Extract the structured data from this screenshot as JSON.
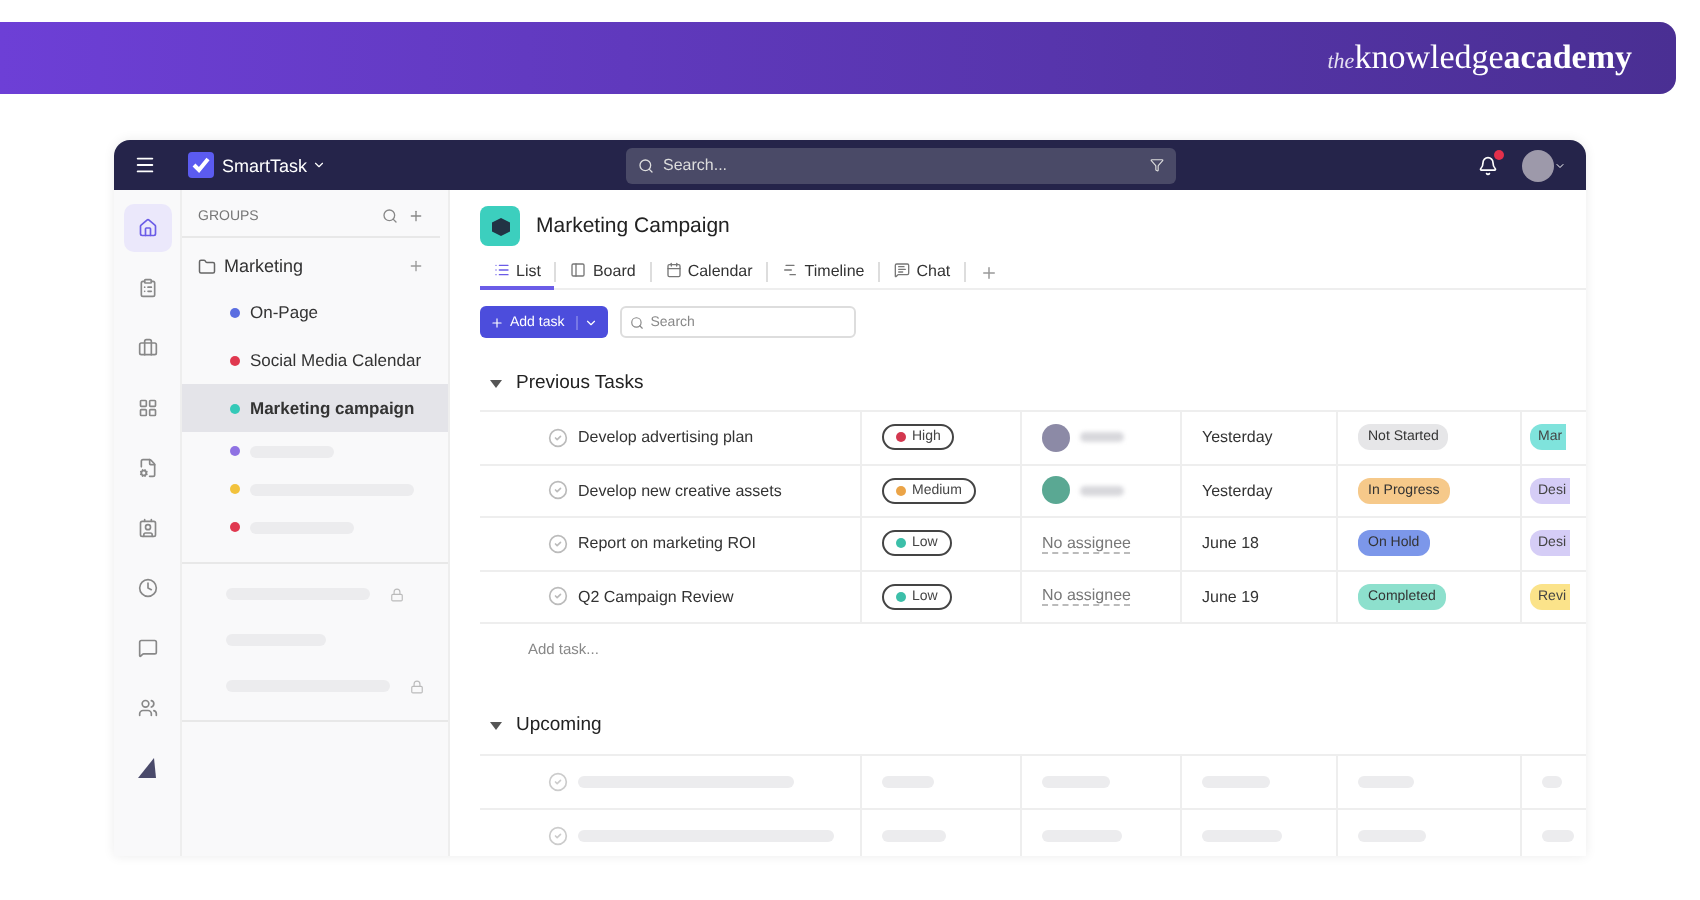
{
  "banner": {
    "logo_prefix": "the",
    "logo_main": "knowledge",
    "logo_bold": "academy"
  },
  "topbar": {
    "app_name": "SmartTask",
    "search_placeholder": "Search..."
  },
  "rail": [
    {
      "selected": true
    },
    {
      "selected": false
    },
    {
      "selected": false
    },
    {
      "selected": false
    },
    {
      "selected": false
    },
    {
      "selected": false
    },
    {
      "selected": false
    },
    {
      "selected": false
    },
    {
      "selected": false
    },
    {
      "selected": false
    }
  ],
  "groups": {
    "title": "GROUPS",
    "folder": "Marketing",
    "items": [
      {
        "kind": "named",
        "label": "On-Page",
        "color": "#5b6ee1",
        "selected": false
      },
      {
        "kind": "named",
        "label": "Social Media Calendar",
        "color": "#e0384f",
        "selected": false
      },
      {
        "kind": "named",
        "label": "Marketing campaign",
        "color": "#34c9b8",
        "selected": true
      },
      {
        "kind": "loading",
        "color": "#8f72e3",
        "selected": false
      },
      {
        "kind": "loading",
        "color": "#f2c23c",
        "selected": false
      },
      {
        "kind": "loading",
        "color": "#e0384f",
        "selected": false
      }
    ]
  },
  "project": {
    "title": "Marketing Campaign"
  },
  "tabs": [
    {
      "label": "List",
      "selected": true
    },
    {
      "label": "Board",
      "selected": false
    },
    {
      "label": "Calendar",
      "selected": false
    },
    {
      "label": "Timeline",
      "selected": false
    },
    {
      "label": "Chat",
      "selected": false
    }
  ],
  "toolbar": {
    "add_task": "Add task",
    "search_placeholder": "Search"
  },
  "sections": [
    {
      "kind": "tasks",
      "title": "Previous Tasks",
      "expanded": true,
      "add_task": "Add task...",
      "tasks": [
        {
          "name": "Develop advertising plan",
          "priority": {
            "label": "High",
            "color": "#d3374f"
          },
          "assignee": {
            "kind": "person"
          },
          "date": "Yesterday",
          "status": {
            "label": "Not Started",
            "color": "#e6e6e8"
          },
          "tag": {
            "label": "Mar",
            "color": "#7fe3dc"
          }
        },
        {
          "name": "Develop new creative assets",
          "priority": {
            "label": "Medium",
            "color": "#eba447"
          },
          "assignee": {
            "kind": "person"
          },
          "date": "Yesterday",
          "status": {
            "label": "In Progress",
            "color": "#f6c98a"
          },
          "tag": {
            "label": "Desi",
            "color": "#d5cdf6"
          }
        },
        {
          "name": "Report on marketing ROI",
          "priority": {
            "label": "Low",
            "color": "#3cbfa9"
          },
          "assignee": {
            "kind": "none",
            "label": "No assignee"
          },
          "date": "June 18",
          "status": {
            "label": "On Hold",
            "color": "#7c97ea"
          },
          "tag": {
            "label": "Desi",
            "color": "#d5cdf6"
          }
        },
        {
          "name": "Q2 Campaign Review",
          "priority": {
            "label": "Low",
            "color": "#3cbfa9"
          },
          "assignee": {
            "kind": "none",
            "label": "No assignee"
          },
          "date": "June 19",
          "status": {
            "label": "Completed",
            "color": "#8de0cd"
          },
          "tag": {
            "label": "Revi",
            "color": "#fbe38a"
          }
        }
      ]
    },
    {
      "kind": "loading",
      "title": "Upcoming",
      "expanded": true
    }
  ]
}
